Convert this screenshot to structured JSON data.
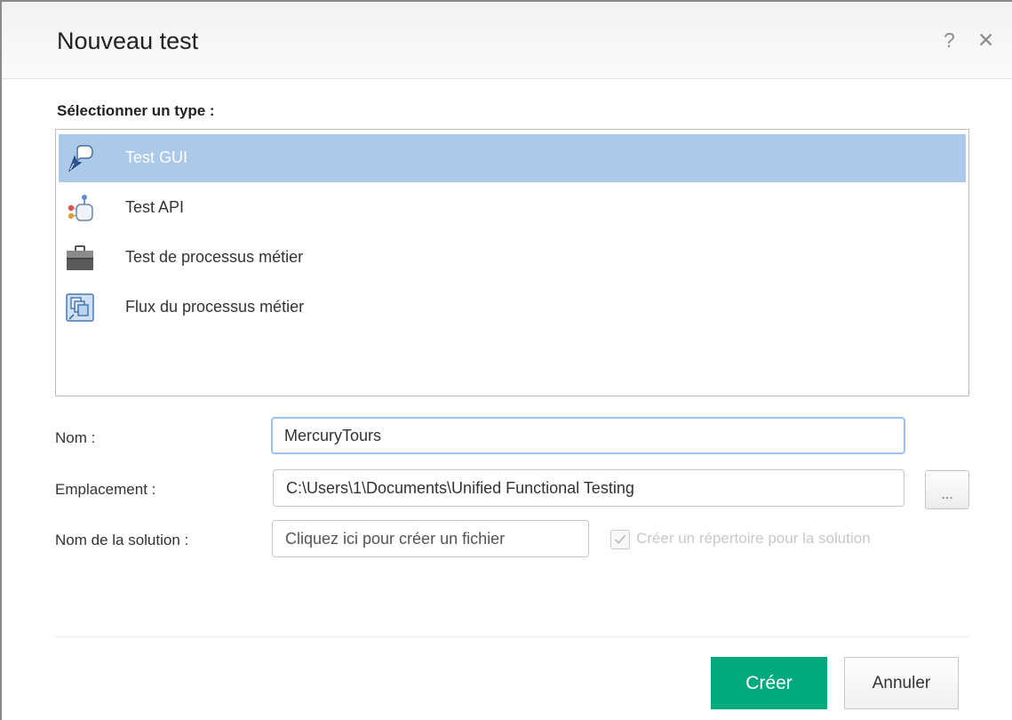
{
  "dialog": {
    "title": "Nouveau test",
    "help_label": "?",
    "close_label": "✕"
  },
  "type_section": {
    "label": "Sélectionner un type :",
    "items": [
      {
        "label": "Test GUI",
        "icon": "gui-test-icon",
        "selected": true
      },
      {
        "label": "Test API",
        "icon": "api-test-icon",
        "selected": false
      },
      {
        "label": "Test de processus métier",
        "icon": "briefcase-icon",
        "selected": false
      },
      {
        "label": "Flux du processus métier",
        "icon": "flow-icon",
        "selected": false
      }
    ]
  },
  "form": {
    "name_label": "Nom :",
    "name_value": "MercuryTours",
    "location_label": "Emplacement :",
    "location_value": "C:\\Users\\1\\Documents\\Unified Functional Testing",
    "browse_label": "...",
    "solution_label": "Nom de la solution :",
    "solution_placeholder": "Cliquez ici pour créer un fichier",
    "create_dir_label": "Créer un répertoire pour la solution",
    "create_dir_checked": true
  },
  "buttons": {
    "create": "Créer",
    "cancel": "Annuler"
  },
  "colors": {
    "selection": "#abc9e8",
    "primary_button": "#00a97e",
    "focus_border": "#9cc4ea"
  }
}
